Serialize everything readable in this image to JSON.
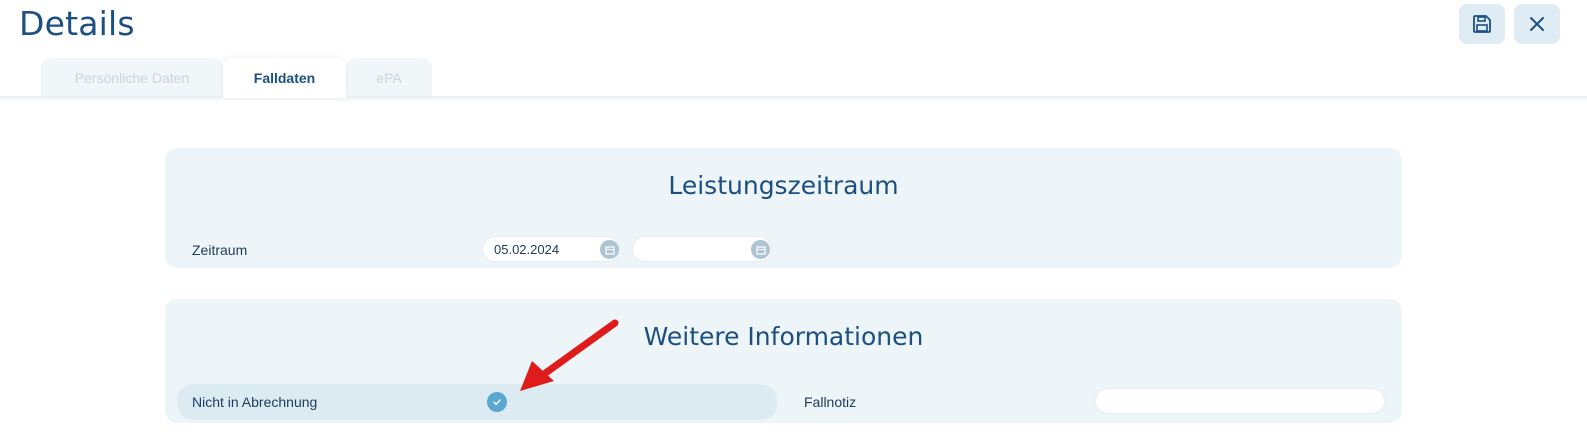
{
  "header": {
    "title": "Details"
  },
  "toolbar": {
    "save_icon": "save-icon",
    "close_icon": "close-icon"
  },
  "tabs": [
    {
      "label": "Persönliche Daten",
      "active": false
    },
    {
      "label": "Falldaten",
      "active": true
    },
    {
      "label": "ePA",
      "active": false
    }
  ],
  "leistungszeitraum": {
    "title": "Leistungszeitraum",
    "zeitraum_label": "Zeitraum",
    "start_date": "05.02.2024",
    "end_date": ""
  },
  "weitere": {
    "title": "Weitere Informationen",
    "nicht_in_abrechnung_label": "Nicht in Abrechnung",
    "nicht_in_abrechnung_checked": true,
    "fallnotiz_label": "Fallnotiz",
    "fallnotiz_value": ""
  },
  "colors": {
    "primary": "#1c4f82",
    "card_bg": "#eef5f8",
    "check": "#5aa8cf",
    "annotation_arrow": "#e01b1b"
  }
}
